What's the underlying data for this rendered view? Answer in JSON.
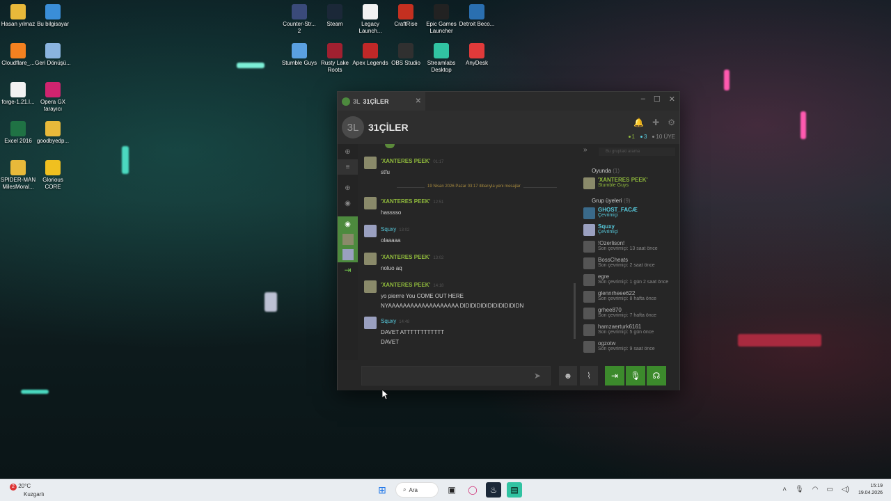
{
  "desktop": {
    "icons": [
      {
        "label": "Hasan yılmaz",
        "icon": "folder-icon"
      },
      {
        "label": "Bu bilgisayar",
        "icon": "monitor-icon"
      },
      {
        "label": "Cloudflare_...",
        "icon": "cloudflare-icon"
      },
      {
        "label": "Geri Dönüşü...",
        "icon": "recycle-bin-icon"
      },
      {
        "label": "forge-1.21.l...",
        "icon": "file-icon"
      },
      {
        "label": "Opera GX tarayıcı",
        "icon": "opera-gx-icon"
      },
      {
        "label": "Excel 2016",
        "icon": "excel-icon"
      },
      {
        "label": "goodbyedp...",
        "icon": "folder-icon"
      },
      {
        "label": "SPIDER-MAN MilesMoral...",
        "icon": "folder-icon"
      },
      {
        "label": "Glorious CORE",
        "icon": "glorious-icon"
      },
      {
        "label": "Counter-Str... 2",
        "icon": "cs2-icon"
      },
      {
        "label": "Steam",
        "icon": "steam-icon"
      },
      {
        "label": "Legacy Launch...",
        "icon": "file-icon"
      },
      {
        "label": "CraftRise",
        "icon": "craftrise-icon"
      },
      {
        "label": "Epic Games Launcher",
        "icon": "epic-icon"
      },
      {
        "label": "Detroit Beco...",
        "icon": "detroit-icon"
      },
      {
        "label": "Stumble Guys",
        "icon": "stumble-icon"
      },
      {
        "label": "Rusty Lake Roots",
        "icon": "rusty-lake-icon"
      },
      {
        "label": "Apex Legends",
        "icon": "apex-icon"
      },
      {
        "label": "OBS Studio",
        "icon": "obs-icon"
      },
      {
        "label": "Streamlabs Desktop",
        "icon": "streamlabs-icon"
      },
      {
        "label": "AnyDesk",
        "icon": "anydesk-icon"
      }
    ]
  },
  "window": {
    "tab_title": "31ÇİLER",
    "tab_icon_text": "3L",
    "group_icon_text": "3L",
    "group_name": "31ÇİLER",
    "stats": {
      "in_game": "1",
      "online": "3",
      "members": "10 ÜYE"
    },
    "search_placeholder": "Bu gruptaki arama",
    "separator_text": "19 Nisan 2026 Pazar 03:17 itibarıyla yeni mesajlar",
    "messages": [
      {
        "author": "'XANTERES PEEK'",
        "time": "01:17",
        "lines": [
          "stfu"
        ]
      },
      {
        "author": "'XANTERES PEEK'",
        "time": "12:51",
        "lines": [
          "hasssso"
        ]
      },
      {
        "author": "Squxy",
        "time": "13:02",
        "lines": [
          "olaaaaa"
        ]
      },
      {
        "author": "'XANTERES PEEK'",
        "time": "13:02",
        "lines": [
          "noluo aq"
        ]
      },
      {
        "author": "'XANTERES PEEK'",
        "time": "14:18",
        "lines": [
          "yo pierrre You COME OUT HERE",
          "NYAAAAAAAAAAAAAAAAAAA DIDIDIDIDIDIDIDIDIDIDN"
        ]
      },
      {
        "author": "Squxy",
        "time": "14:48",
        "lines": [
          "DAVET ATTTTTTTTTTTT",
          "DAVET"
        ]
      }
    ],
    "members": {
      "ingame_header": "Oyunda",
      "ingame_count": "(1)",
      "ingame": [
        {
          "name": "'XANTERES PEEK'",
          "status": "Stumble Guys"
        }
      ],
      "group_header": "Grup üyeleri",
      "group_count": "(9)",
      "group": [
        {
          "name": "GHOST_FACÆ",
          "status": "Çevrimiçi"
        },
        {
          "name": "Squxy",
          "status": "Çevrimiçi"
        },
        {
          "name": "!Ozerlison!",
          "status": "Son çevrimiçi: 13 saat önce"
        },
        {
          "name": "BossCheats",
          "status": "Son çevrimiçi: 2 saat önce"
        },
        {
          "name": "egre",
          "status": "Son çevrimiçi: 1 gün 2 saat önce"
        },
        {
          "name": "glennrheee622",
          "status": "Son çevrimiçi: 8 hafta önce"
        },
        {
          "name": "grhee870",
          "status": "Son çevrimiçi: 7 hafta önce"
        },
        {
          "name": "hamzaerturk6161",
          "status": "Son çevrimiçi: 5 gün önce"
        },
        {
          "name": "ogzotw",
          "status": "Son çevrimiçi: 9 saat önce"
        }
      ]
    }
  },
  "taskbar": {
    "weather_temp": "20°C",
    "weather_desc": "Kuzgarlı",
    "weather_badge": "2",
    "search_label": "Ara",
    "time": "15:19",
    "date": "19.04.2026"
  },
  "colors": {
    "ingame_green": "#90ba3c",
    "online_blue": "#57cbde",
    "offline_gray": "#898989",
    "accent_green": "#3c8a2c"
  }
}
